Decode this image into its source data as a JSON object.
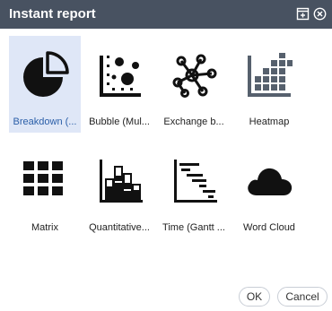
{
  "dialog": {
    "title": "Instant report",
    "icons": [
      "maximize-icon",
      "close-icon"
    ]
  },
  "tiles": [
    {
      "label": "Breakdown (...",
      "icon": "pie-chart-icon",
      "selected": true
    },
    {
      "label": "Bubble (Mul...",
      "icon": "bubble-chart-icon",
      "selected": false
    },
    {
      "label": "Exchange b...",
      "icon": "network-icon",
      "selected": false
    },
    {
      "label": "Heatmap",
      "icon": "heatmap-icon",
      "selected": false
    },
    {
      "label": "Matrix",
      "icon": "matrix-grid-icon",
      "selected": false
    },
    {
      "label": "Quantitative...",
      "icon": "stacked-bar-chart-icon",
      "selected": false
    },
    {
      "label": "Time (Gantt ...",
      "icon": "gantt-chart-icon",
      "selected": false
    },
    {
      "label": "Word Cloud",
      "icon": "cloud-icon",
      "selected": false
    }
  ],
  "buttons": {
    "ok": "OK",
    "cancel": "Cancel"
  },
  "colors": {
    "titlebar": "#485261",
    "selected_tile": "#dfe7f7",
    "heatmap": "#56606d",
    "icon": "#111111"
  }
}
